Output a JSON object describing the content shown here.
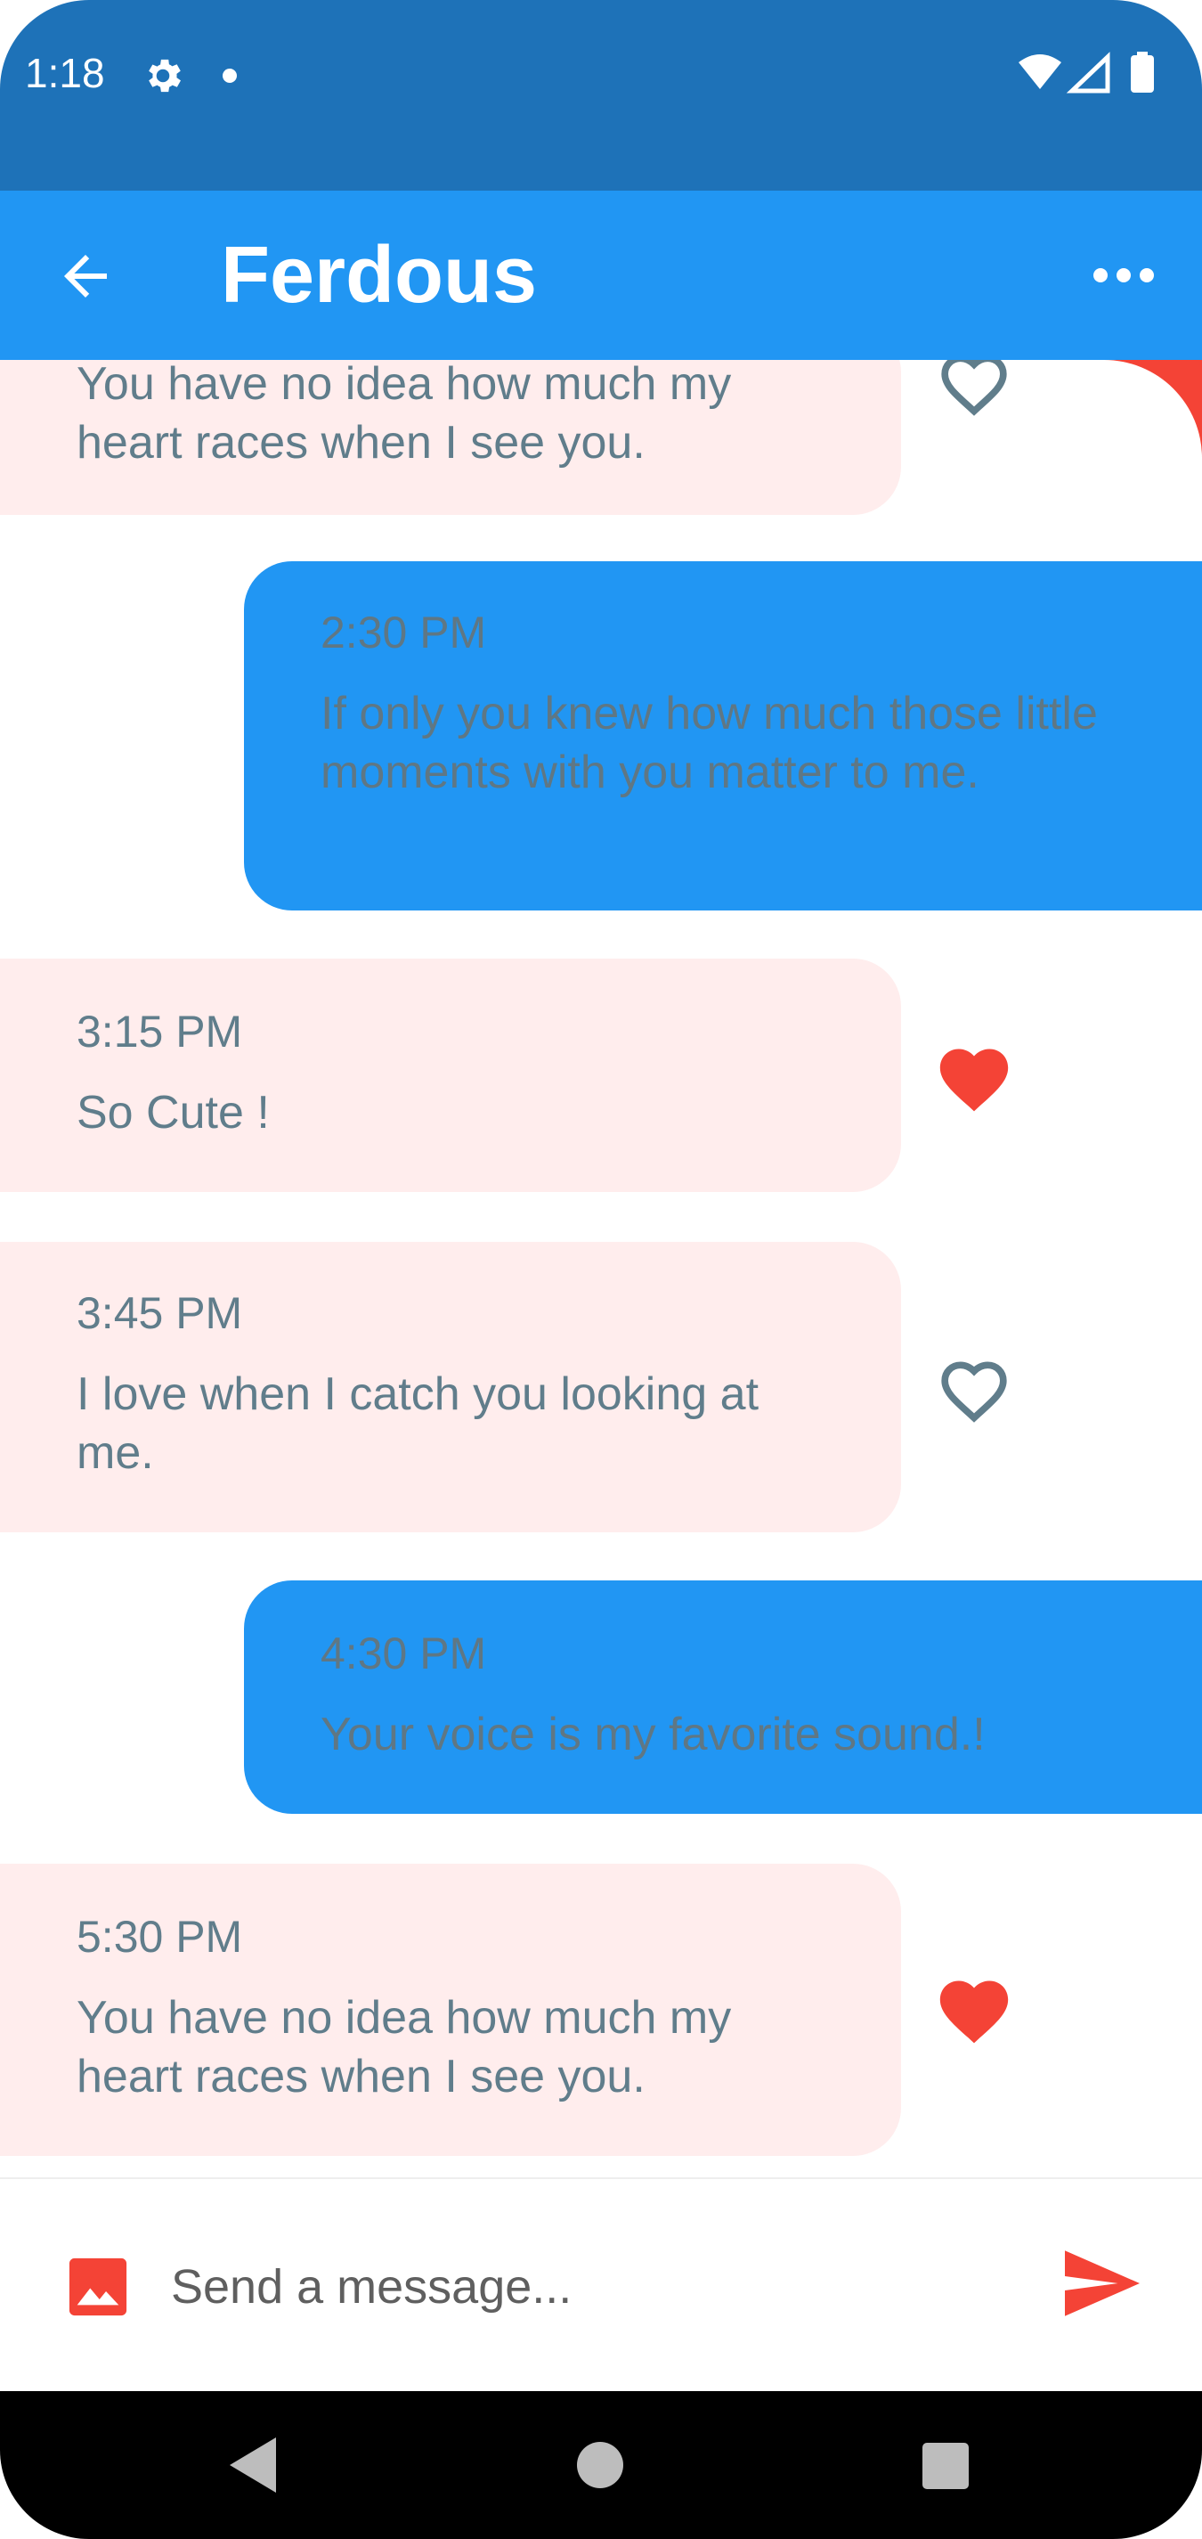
{
  "status_bar": {
    "time": "1:18"
  },
  "app_bar": {
    "title": "Ferdous"
  },
  "messages": [
    {
      "direction": "incoming",
      "time": "",
      "text": "You have no idea how much my heart races when I see you.",
      "liked": false
    },
    {
      "direction": "outgoing",
      "time": "2:30 PM",
      "text": "If only you knew how much those little moments with you matter to me."
    },
    {
      "direction": "incoming",
      "time": "3:15 PM",
      "text": "So Cute !",
      "liked": true
    },
    {
      "direction": "incoming",
      "time": "3:45 PM",
      "text": "I love when I catch you looking at me.",
      "liked": false
    },
    {
      "direction": "outgoing",
      "time": "4:30 PM",
      "text": "Your voice is my favorite sound.!"
    },
    {
      "direction": "incoming",
      "time": "5:30 PM",
      "text": "You have no idea how much my heart races when I see you.",
      "liked": true
    }
  ],
  "composer": {
    "placeholder": "Send a message..."
  },
  "colors": {
    "status_bar": "#1e72b8",
    "app_bar": "#2196f3",
    "incoming_bubble": "#ffeded",
    "outgoing_bubble": "#2196f3",
    "accent": "#f44336",
    "text": "#607d8b"
  },
  "icons": {
    "back": "arrow-back-icon",
    "more": "more-horiz-icon",
    "like_filled": "heart-filled-icon",
    "like_outline": "heart-outline-icon",
    "image": "image-icon",
    "send": "send-icon"
  }
}
